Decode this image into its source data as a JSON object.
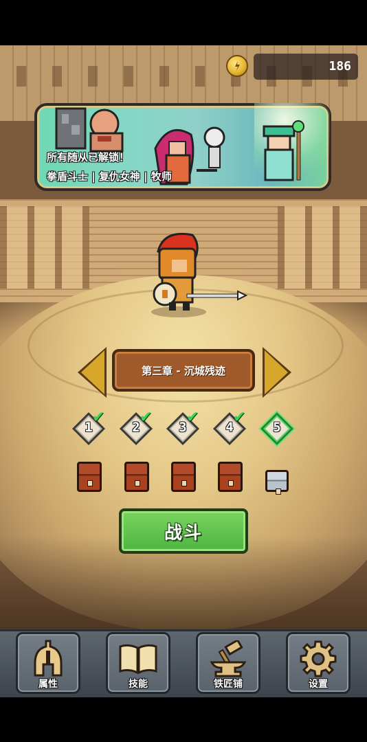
{
  "hud": {
    "coin_icon": "gold-coin-icon",
    "coin_count": "186"
  },
  "banner": {
    "line1": "所有随从已解锁！",
    "line2": "拳盾斗士 | 复仇女神 | 牧师"
  },
  "chapter": {
    "title": "第三章 - 沉城残迹",
    "prev_icon": "arrow-left-icon",
    "next_icon": "arrow-right-icon"
  },
  "levels": [
    {
      "label": "1",
      "completed": true
    },
    {
      "label": "2",
      "completed": true
    },
    {
      "label": "3",
      "completed": true
    },
    {
      "label": "4",
      "completed": true
    },
    {
      "label": "5",
      "completed": false,
      "current": true
    }
  ],
  "battle_button": {
    "label": "战斗"
  },
  "nav": [
    {
      "label": "属性",
      "icon": "helmet-icon"
    },
    {
      "label": "技能",
      "icon": "book-icon"
    },
    {
      "label": "铁匠铺",
      "icon": "anvil-hammer-icon"
    },
    {
      "label": "设置",
      "icon": "gear-icon"
    }
  ],
  "colors": {
    "accent_green": "#4fb441",
    "check_green": "#3fd25a",
    "chapter_brown": "#a0592a",
    "arrow_gold": "#d6a72b"
  }
}
